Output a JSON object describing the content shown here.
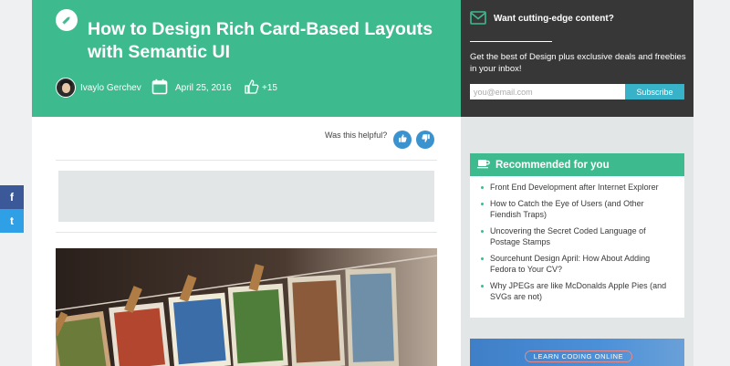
{
  "article": {
    "title": "How to Design Rich Card-Based Layouts with Semantic UI",
    "author": "Ivaylo Gerchev",
    "date": "April 25, 2016",
    "likes": "+15",
    "helpful_prompt": "Was this helpful?"
  },
  "newsletter": {
    "title": "Want cutting-edge content?",
    "description": "Get the best of Design plus exclusive deals and freebies in your inbox!",
    "email_placeholder": "you@email.com",
    "subscribe_label": "Subscribe"
  },
  "share": {
    "facebook_label": "f",
    "twitter_label": "t"
  },
  "sidebar": {
    "recommended_title": "Recommended for you",
    "items": [
      {
        "label": "Front End Development after Internet Explorer"
      },
      {
        "label": "How to Catch the Eye of Users (and Other Fiendish Traps)"
      },
      {
        "label": "Uncovering the Secret Coded Language of Postage Stamps"
      },
      {
        "label": "Sourcehunt Design April: How About Adding Fedora to Your CV?"
      },
      {
        "label": "Why JPEGs are like McDonalds Apple Pies (and SVGs are not)"
      }
    ],
    "promo_label": "LEARN CODING ONLINE"
  },
  "colors": {
    "accent_green": "#3dbb8e",
    "dark_panel": "#373737",
    "button_blue": "#3a92cf",
    "subscribe_cyan": "#38b2c9",
    "facebook_blue": "#3b5998",
    "twitter_blue": "#2fa0e6"
  },
  "icons": {
    "hero_badge": "pencil-icon",
    "date": "calendar-icon",
    "likes": "thumbs-up-icon",
    "newsletter": "envelope-icon",
    "recommended": "coffee-cup-icon"
  }
}
